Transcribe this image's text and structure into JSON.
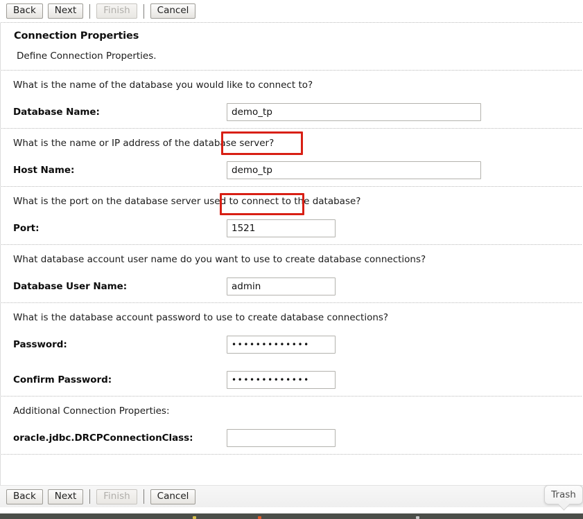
{
  "toolbar": {
    "back_label": "Back",
    "next_label": "Next",
    "finish_label": "Finish",
    "cancel_label": "Cancel"
  },
  "header": {
    "title": "Connection Properties",
    "subtitle": "Define Connection Properties."
  },
  "sections": [
    {
      "question": "What is the name of the database you would like to connect to?",
      "label": "Database Name:",
      "value": "demo_tp"
    },
    {
      "question": "What is the name or IP address of the database server?",
      "label": "Host Name:",
      "value": "demo_tp"
    },
    {
      "question": "What is the port on the database server used to connect to the database?",
      "label": "Port:",
      "value": "1521"
    },
    {
      "question": "What database account user name do you want to use to create database connections?",
      "label": "Database User Name:",
      "value": "admin"
    },
    {
      "question": "What is the database account password to use to create database connections?",
      "label": "Password:",
      "value": "•••••••••••••",
      "label2": "Confirm Password:",
      "value2": "•••••••••••••"
    },
    {
      "question": "Additional Connection Properties:",
      "label": "oracle.jdbc.DRCPConnectionClass:",
      "value": ""
    }
  ],
  "annotations": {
    "color": "#d81f14",
    "database_name_highlight": "demo_tp",
    "host_name_highlight": "demo_tp"
  },
  "desktop": {
    "trash_tooltip": "Trash"
  }
}
